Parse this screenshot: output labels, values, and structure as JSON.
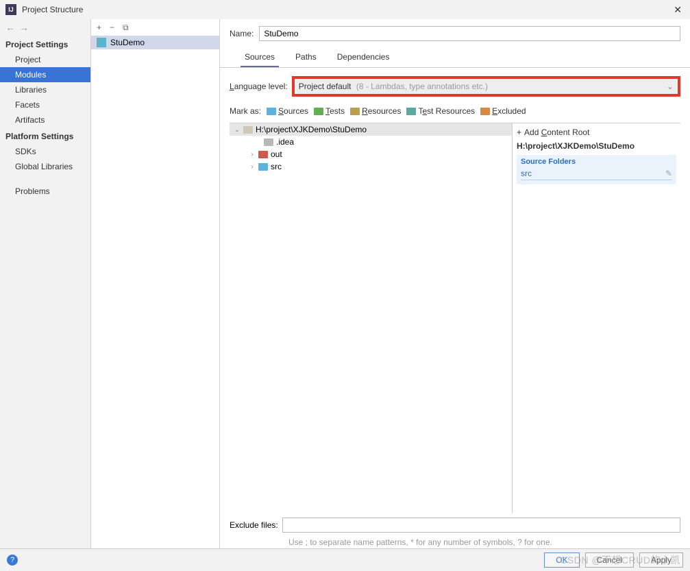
{
  "window": {
    "title": "Project Structure"
  },
  "sidebar": {
    "sections": [
      {
        "title": "Project Settings",
        "items": [
          "Project",
          "Modules",
          "Libraries",
          "Facets",
          "Artifacts"
        ],
        "activeIndex": 1
      },
      {
        "title": "Platform Settings",
        "items": [
          "SDKs",
          "Global Libraries"
        ]
      },
      {
        "title": "",
        "items": [
          "Problems"
        ]
      }
    ]
  },
  "moduleList": {
    "selected": "StuDemo"
  },
  "name": {
    "label": "Name:",
    "value": "StuDemo"
  },
  "tabs": {
    "items": [
      "Sources",
      "Paths",
      "Dependencies"
    ],
    "activeIndex": 0
  },
  "langLevel": {
    "label": "Language level:",
    "value": "Project default",
    "hint": "(8 - Lambdas, type annotations etc.)"
  },
  "markAs": {
    "label": "Mark as:",
    "items": [
      {
        "label": "Sources",
        "color": "blue"
      },
      {
        "label": "Tests",
        "color": "green"
      },
      {
        "label": "Resources",
        "color": "yellow"
      },
      {
        "label": "Test Resources",
        "color": "teal"
      },
      {
        "label": "Excluded",
        "color": "orange"
      }
    ]
  },
  "tree": {
    "root": "H:\\project\\XJKDemo\\StuDemo",
    "children": [
      {
        "name": ".idea",
        "color": "grey",
        "expandable": false
      },
      {
        "name": "out",
        "color": "red",
        "expandable": true
      },
      {
        "name": "src",
        "color": "blue",
        "expandable": true
      }
    ]
  },
  "contentRoot": {
    "addLabel": "Add Content Root",
    "path": "H:\\project\\XJKDemo\\StuDemo",
    "sourceFolders": {
      "title": "Source Folders",
      "items": [
        "src"
      ]
    }
  },
  "exclude": {
    "label": "Exclude files:",
    "value": "",
    "hint": "Use ; to separate name patterns, * for any number of symbols, ? for one."
  },
  "footer": {
    "ok": "OK",
    "cancel": "Cancel",
    "apply": "Apply"
  },
  "watermark": "CSDN @不想CRUD的小凯"
}
